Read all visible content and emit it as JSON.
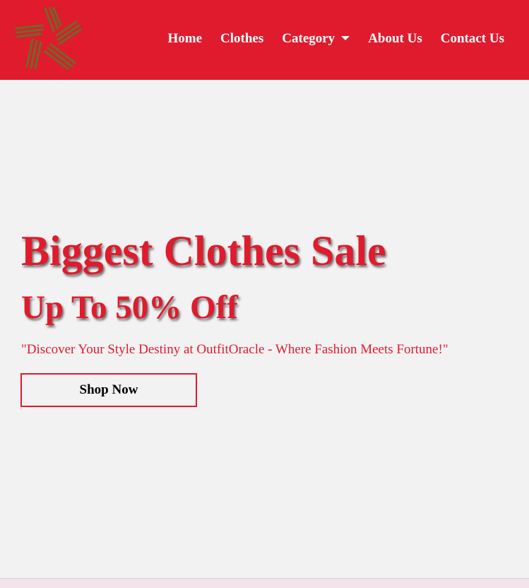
{
  "brand": {
    "logo_icon": "star-hangers-logo",
    "logo_color": "#6b6a2a"
  },
  "nav": {
    "items": [
      {
        "label": "Home"
      },
      {
        "label": "Clothes"
      },
      {
        "label": "Category",
        "has_dropdown": true,
        "dropdown_icon": "caret-down-icon"
      },
      {
        "label": "About Us"
      },
      {
        "label": "Contact Us"
      }
    ]
  },
  "hero": {
    "headline": "Biggest Clothes Sale",
    "subheadline": "Up To 50% Off",
    "tagline": "\"Discover Your Style Destiny at OutfitOracle - Where Fashion Meets Fortune!\"",
    "cta_label": "Shop Now"
  },
  "colors": {
    "brand_red": "#e01b2d",
    "background": "#f2f2f2",
    "nav_text": "#ffffff",
    "cta_text": "#000000"
  }
}
